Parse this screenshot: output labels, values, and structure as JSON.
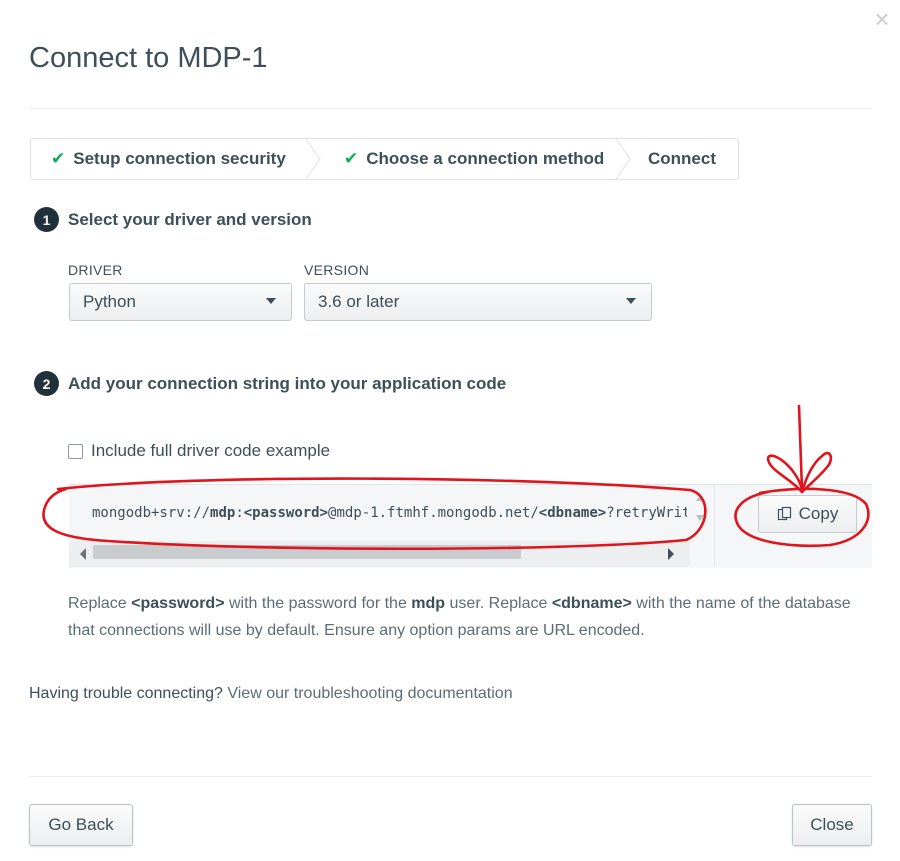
{
  "dialog": {
    "title": "Connect to MDP-1",
    "close_glyph": "×"
  },
  "steps": [
    {
      "label": "Setup connection security",
      "done": true
    },
    {
      "label": "Choose a connection method",
      "done": true
    },
    {
      "label": "Connect",
      "done": false
    }
  ],
  "section1": {
    "number": "1",
    "heading": "Select your driver and version",
    "driver_label": "DRIVER",
    "driver_value": "Python",
    "version_label": "VERSION",
    "version_value": "3.6 or later"
  },
  "section2": {
    "number": "2",
    "heading": "Add your connection string into your application code",
    "checkbox_label": "Include full driver code example",
    "conn_prefix": "mongodb+srv://",
    "conn_user": "mdp",
    "conn_colon": ":",
    "conn_password": "<password>",
    "conn_host": "@mdp-1.ftmhf.mongodb.net/",
    "conn_dbname": "<dbname>",
    "conn_suffix": "?retryWrites=true&w=majority",
    "copy_label": "Copy"
  },
  "help": {
    "t1": "Replace ",
    "password": "<password>",
    "t2": " with the password for the ",
    "user": "mdp",
    "t3": " user. Replace ",
    "dbname": "<dbname>",
    "t4": " with the name of the database that connections will use by default. Ensure any option params are URL encoded."
  },
  "trouble": {
    "text": "Having trouble connecting?",
    "link": "View our troubleshooting documentation"
  },
  "footer": {
    "back_label": "Go Back",
    "close_label": "Close"
  },
  "colors": {
    "check": "#13aa52",
    "annotation": "#e0141c"
  }
}
